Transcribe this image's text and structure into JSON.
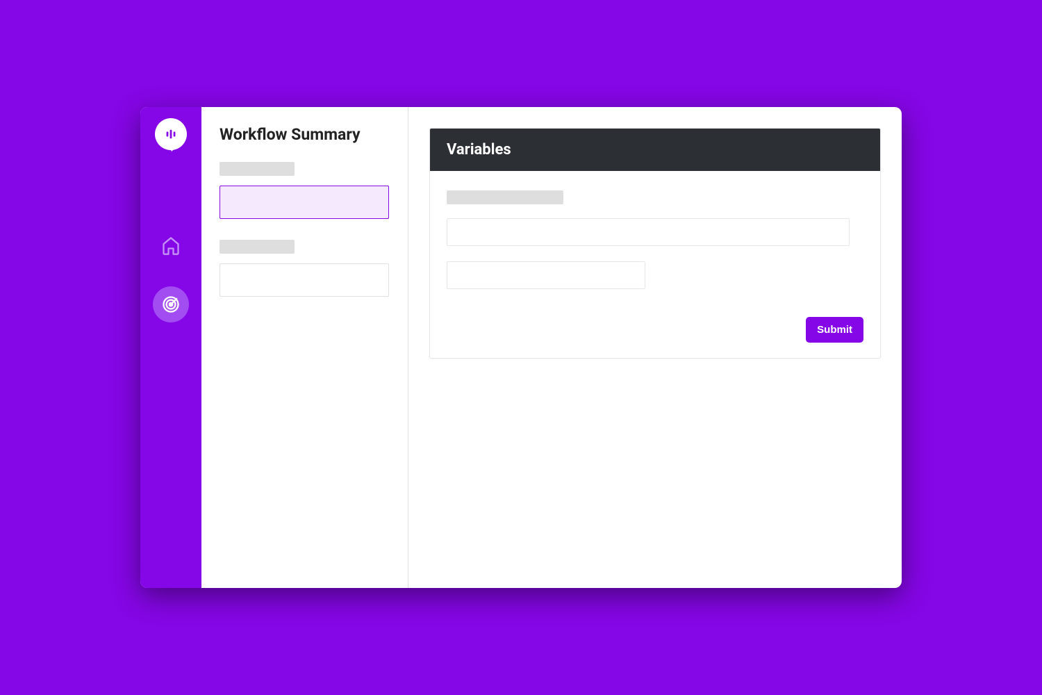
{
  "colors": {
    "accent": "#8506e6",
    "card_header_bg": "#2c3035"
  },
  "rail": {
    "logo_icon": "voice-bubble-icon",
    "items": [
      {
        "icon": "home-icon",
        "active": false
      },
      {
        "icon": "radar-icon",
        "active": true
      }
    ]
  },
  "left": {
    "title": "Workflow Summary",
    "sections": [
      {
        "label_placeholder": true,
        "input_selected": true
      },
      {
        "label_placeholder": true,
        "input_selected": false
      }
    ]
  },
  "main": {
    "card": {
      "header": "Variables",
      "label_placeholder": true,
      "fields": [
        {
          "value": "",
          "width": "full"
        },
        {
          "value": "",
          "width": "half"
        }
      ],
      "submit_label": "Submit"
    }
  }
}
